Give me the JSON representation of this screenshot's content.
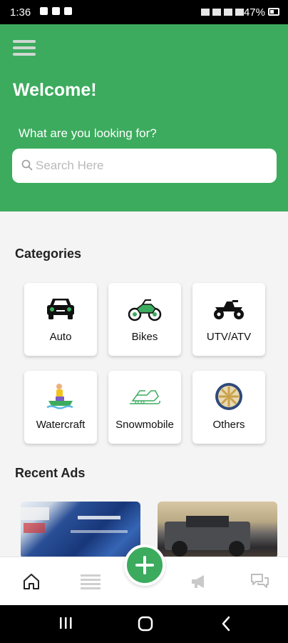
{
  "status_bar": {
    "time": "1:36",
    "battery": "47%"
  },
  "header": {
    "welcome": "Welcome!",
    "prompt": "What are you looking for?",
    "search": {
      "placeholder": "Search Here",
      "value": ""
    }
  },
  "categories": {
    "title": "Categories",
    "items": [
      {
        "label": "Auto",
        "icon": "car-icon"
      },
      {
        "label": "Bikes",
        "icon": "motorcycle-icon"
      },
      {
        "label": "UTV/ATV",
        "icon": "atv-icon"
      },
      {
        "label": "Watercraft",
        "icon": "jetski-icon"
      },
      {
        "label": "Snowmobile",
        "icon": "snowmobile-icon"
      },
      {
        "label": "Others",
        "icon": "wheel-icon"
      }
    ]
  },
  "recent_ads": {
    "title": "Recent Ads"
  },
  "bottom_nav": {
    "items": [
      "home-icon",
      "list-icon",
      "add-icon",
      "megaphone-icon",
      "chat-icon"
    ]
  },
  "colors": {
    "brand": "#3cab5e"
  }
}
